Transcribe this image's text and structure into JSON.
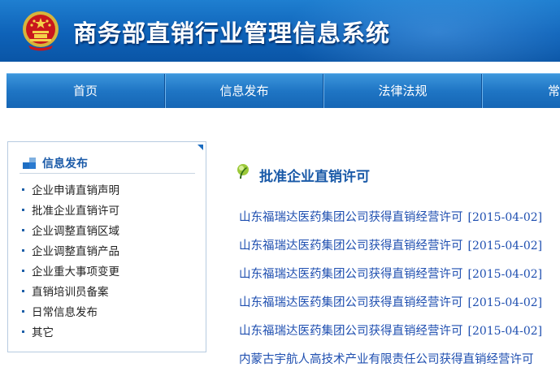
{
  "header": {
    "title": "商务部直销行业管理信息系统",
    "emblem_icon": "national-emblem-icon"
  },
  "nav": {
    "items": [
      {
        "label": "首页"
      },
      {
        "label": "信息发布"
      },
      {
        "label": "法律法规"
      },
      {
        "label": "常见"
      }
    ]
  },
  "sidebar": {
    "title": "信息发布",
    "items": [
      {
        "label": "企业申请直销声明"
      },
      {
        "label": "批准企业直销许可"
      },
      {
        "label": "企业调整直销区域"
      },
      {
        "label": "企业调整直销产品"
      },
      {
        "label": "企业重大事项变更"
      },
      {
        "label": "直销培训员备案"
      },
      {
        "label": "日常信息发布"
      },
      {
        "label": "其它"
      }
    ]
  },
  "main": {
    "section_title": "批准企业直销许可",
    "news": [
      {
        "title": "山东福瑞达医药集团公司获得直销经营许可",
        "date": "[2015-04-02]"
      },
      {
        "title": "山东福瑞达医药集团公司获得直销经营许可",
        "date": "[2015-04-02]"
      },
      {
        "title": "山东福瑞达医药集团公司获得直销经营许可",
        "date": "[2015-04-02]"
      },
      {
        "title": "山东福瑞达医药集团公司获得直销经营许可",
        "date": "[2015-04-02]"
      },
      {
        "title": "山东福瑞达医药集团公司获得直销经营许可",
        "date": "[2015-04-02]"
      },
      {
        "title": "内蒙古宇航人高技术产业有限责任公司获得直销经营许可",
        "date": ""
      }
    ]
  },
  "colors": {
    "header_blue": "#0e62b8",
    "nav_blue": "#1f75c4",
    "link_blue": "#1f4fb0",
    "title_blue": "#1a5aa8"
  }
}
